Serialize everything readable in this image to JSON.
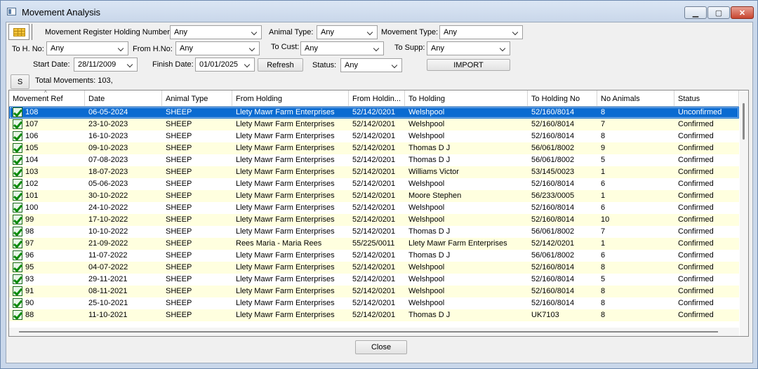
{
  "window": {
    "title": "Movement Analysis"
  },
  "filters": {
    "movement_register_label": "Movement Register Holding Number:",
    "movement_register_value": "Any",
    "animal_type_label": "Animal Type:",
    "animal_type_value": "Any",
    "movement_type_label": "Movement Type:",
    "movement_type_value": "Any",
    "to_hno_label": "To H. No:",
    "to_hno_value": "Any",
    "from_hno_label": "From H.No:",
    "from_hno_value": "Any",
    "to_cust_label": "To Cust:",
    "to_cust_value": "Any",
    "to_supp_label": "To Supp:",
    "to_supp_value": "Any",
    "start_date_label": "Start Date:",
    "start_date_value": "28/11/2009",
    "finish_date_label": "Finish Date:",
    "finish_date_value": "01/01/2025",
    "refresh_label": "Refresh",
    "status_label": "Status:",
    "status_value": "Any",
    "import_label": "IMPORT",
    "s_button_label": "S",
    "total_movements": "Total Movements: 103,"
  },
  "grid": {
    "columns": [
      "Movement Ref",
      "Date",
      "Animal Type",
      "From Holding",
      "From Holdin...",
      "To Holding",
      "To Holding No",
      "No Animals",
      "Status"
    ],
    "rows": [
      [
        "108",
        "06-05-2024",
        "SHEEP",
        "Llety Mawr Farm Enterprises",
        "52/142/0201",
        "Welshpool",
        "52/160/8014",
        "8",
        "Unconfirmed"
      ],
      [
        "107",
        "23-10-2023",
        "SHEEP",
        "Llety Mawr Farm Enterprises",
        "52/142/0201",
        "Welshpool",
        "52/160/8014",
        "7",
        "Confirmed"
      ],
      [
        "106",
        "16-10-2023",
        "SHEEP",
        "Llety Mawr Farm Enterprises",
        "52/142/0201",
        "Welshpool",
        "52/160/8014",
        "8",
        "Confirmed"
      ],
      [
        "105",
        "09-10-2023",
        "SHEEP",
        "Llety Mawr Farm Enterprises",
        "52/142/0201",
        "Thomas D J",
        "56/061/8002",
        "9",
        "Confirmed"
      ],
      [
        "104",
        "07-08-2023",
        "SHEEP",
        "Llety Mawr Farm Enterprises",
        "52/142/0201",
        "Thomas D J",
        "56/061/8002",
        "5",
        "Confirmed"
      ],
      [
        "103",
        "18-07-2023",
        "SHEEP",
        "Llety Mawr Farm Enterprises",
        "52/142/0201",
        "Williams Victor",
        "53/145/0023",
        "1",
        "Confirmed"
      ],
      [
        "102",
        "05-06-2023",
        "SHEEP",
        "Llety Mawr Farm Enterprises",
        "52/142/0201",
        "Welshpool",
        "52/160/8014",
        "6",
        "Confirmed"
      ],
      [
        "101",
        "30-10-2022",
        "SHEEP",
        "Llety Mawr Farm Enterprises",
        "52/142/0201",
        "Moore Stephen",
        "56/233/0005",
        "1",
        "Confirmed"
      ],
      [
        "100",
        "24-10-2022",
        "SHEEP",
        "Llety Mawr Farm Enterprises",
        "52/142/0201",
        "Welshpool",
        "52/160/8014",
        "6",
        "Confirmed"
      ],
      [
        "99",
        "17-10-2022",
        "SHEEP",
        "Llety Mawr Farm Enterprises",
        "52/142/0201",
        "Welshpool",
        "52/160/8014",
        "10",
        "Confirmed"
      ],
      [
        "98",
        "10-10-2022",
        "SHEEP",
        "Llety Mawr Farm Enterprises",
        "52/142/0201",
        "Thomas D J",
        "56/061/8002",
        "7",
        "Confirmed"
      ],
      [
        "97",
        "21-09-2022",
        "SHEEP",
        "Rees Maria - Maria Rees",
        "55/225/0011",
        "Llety Mawr Farm Enterprises",
        "52/142/0201",
        "1",
        "Confirmed"
      ],
      [
        "96",
        "11-07-2022",
        "SHEEP",
        "Llety Mawr Farm Enterprises",
        "52/142/0201",
        "Thomas D J",
        "56/061/8002",
        "6",
        "Confirmed"
      ],
      [
        "95",
        "04-07-2022",
        "SHEEP",
        "Llety Mawr Farm Enterprises",
        "52/142/0201",
        "Welshpool",
        "52/160/8014",
        "8",
        "Confirmed"
      ],
      [
        "93",
        "29-11-2021",
        "SHEEP",
        "Llety Mawr Farm Enterprises",
        "52/142/0201",
        "Welshpool",
        "52/160/8014",
        "5",
        "Confirmed"
      ],
      [
        "91",
        "08-11-2021",
        "SHEEP",
        "Llety Mawr Farm Enterprises",
        "52/142/0201",
        "Welshpool",
        "52/160/8014",
        "8",
        "Confirmed"
      ],
      [
        "90",
        "25-10-2021",
        "SHEEP",
        "Llety Mawr Farm Enterprises",
        "52/142/0201",
        "Welshpool",
        "52/160/8014",
        "8",
        "Confirmed"
      ],
      [
        "88",
        "11-10-2021",
        "SHEEP",
        "Llety Mawr Farm Enterprises",
        "52/142/0201",
        "Thomas D J",
        "UK7103",
        "8",
        "Confirmed"
      ]
    ]
  },
  "footer": {
    "close_label": "Close"
  },
  "colors": {
    "selected_row": "#0a6bd1",
    "alt_row": "#ffffdf"
  },
  "icons": {
    "window_icon": "app-window-icon",
    "grid_icon": "grid-view-icon",
    "row_check": "checkmark-icon"
  }
}
